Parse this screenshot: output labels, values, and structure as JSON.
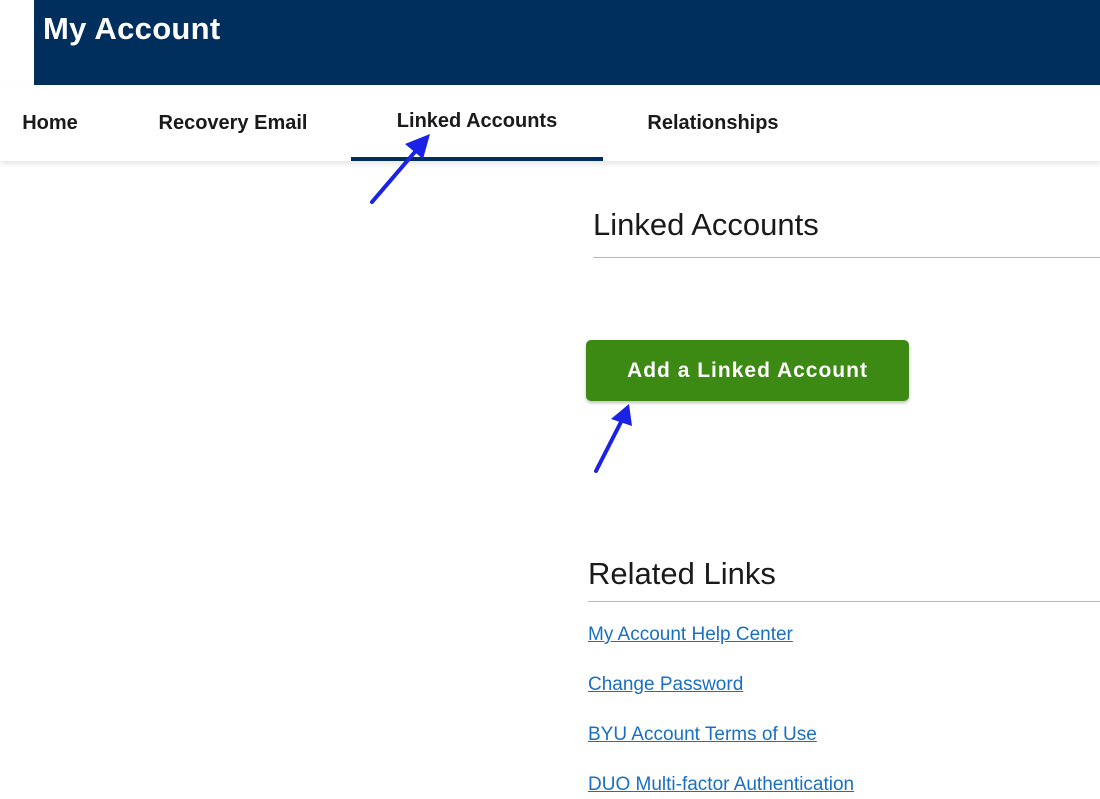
{
  "header": {
    "title": "My Account",
    "background_color": "#002e5d"
  },
  "nav": {
    "tabs": [
      {
        "label": "Home",
        "active": false
      },
      {
        "label": "Recovery Email",
        "active": false
      },
      {
        "label": "Linked Accounts",
        "active": true
      },
      {
        "label": "Relationships",
        "active": false
      }
    ]
  },
  "main": {
    "section_title": "Linked Accounts",
    "add_button_label": "Add a Linked Account",
    "add_button_color": "#3c8a13"
  },
  "related": {
    "title": "Related Links",
    "links": [
      "My Account Help Center",
      "Change Password",
      "BYU Account Terms of Use",
      "DUO Multi-factor Authentication"
    ],
    "link_color": "#1a6fc0"
  },
  "annotations": {
    "arrow_color": "#1a22e6"
  }
}
